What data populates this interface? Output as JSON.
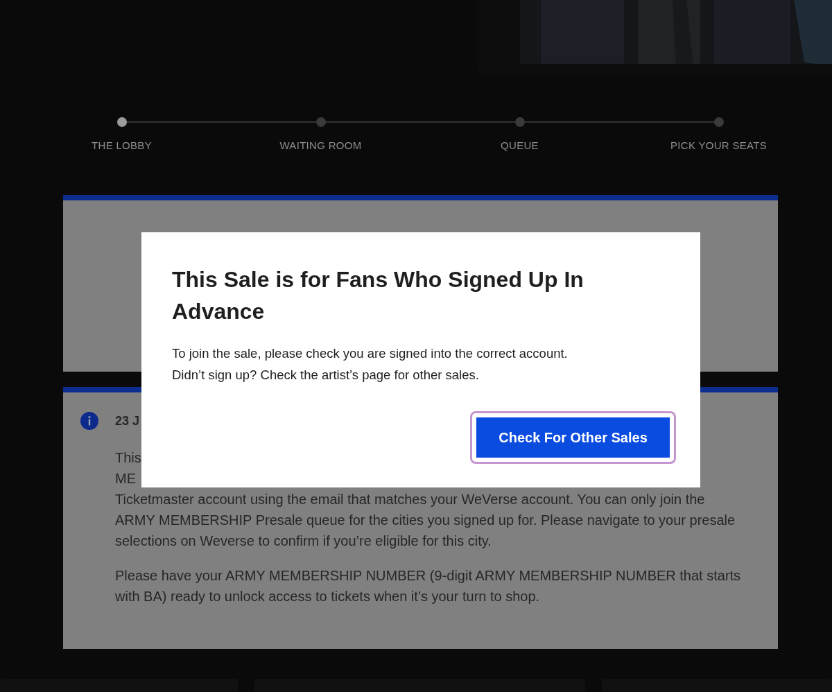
{
  "steps": [
    {
      "label": "THE LOBBY",
      "selected": true
    },
    {
      "label": "WAITING ROOM",
      "selected": false
    },
    {
      "label": "QUEUE",
      "selected": false
    },
    {
      "label": "PICK YOUR SEATS",
      "selected": false
    }
  ],
  "notice_card": {
    "date": "23 J",
    "lines": [
      "This",
      "ME"
    ],
    "paragraphs": [
      "Ticketmaster account using the email that matches your WeVerse account. You can only join the ARMY MEMBERSHIP Presale queue for the cities you signed up for. Please navigate to your presale selections on Weverse to confirm if you’re eligible for this city.",
      "Please have your ARMY MEMBERSHIP NUMBER (9-digit ARMY MEMBERSHIP NUMBER that starts with BA) ready to unlock access to tickets when it’s your turn to shop."
    ]
  },
  "dialog": {
    "title": "This Sale is for Fans Who Signed Up In Advance",
    "message": [
      "To join the sale, please check you are signed into the correct account.",
      "Didn’t sign up? Check the artist’s page for other sales."
    ],
    "button": {
      "label": "Check For Other Sales",
      "focused": true
    }
  }
}
